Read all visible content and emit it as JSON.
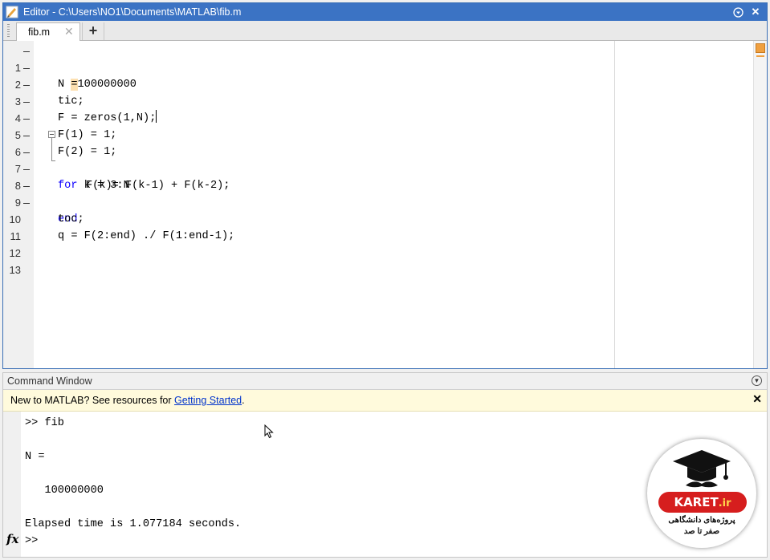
{
  "editor": {
    "title": "Editor - C:\\Users\\NO1\\Documents\\MATLAB\\fib.m",
    "tab_label": "fib.m",
    "tab_close": "✕",
    "tab_add": "+",
    "minimize_glyph": "▾",
    "close_glyph": "✕",
    "line_numbers": [
      "1",
      "2",
      "3",
      "4",
      "5",
      "6",
      "7",
      "8",
      "9",
      "10",
      "11",
      "12",
      "13"
    ],
    "lines": {
      "l1_pre": "N ",
      "l1_hl": "=",
      "l1_post": "100000000",
      "l2": "tic;",
      "l3": "F = zeros(1,N);",
      "l4": "F(1) = 1;",
      "l5": "F(2) = 1;",
      "l6_kw": "for",
      "l6_rest": " k = 3:N",
      "l7": "F(k)= F(k-1) + F(k-2);",
      "l8_kw": "end",
      "l9": "toc;",
      "l10": "q = F(2:end) ./ F(1:end-1);"
    }
  },
  "command_window": {
    "title": "Command Window",
    "info_text": "New to MATLAB? See resources for ",
    "info_link": "Getting Started",
    "info_suffix": ".",
    "info_close": "✕",
    "output": {
      "cmd": ">> fib",
      "n_label": "N =",
      "n_value": "   100000000",
      "elapsed": "Elapsed time is 1.077184 seconds.",
      "prompt": ">>"
    },
    "fx_label": "fx"
  },
  "watermark": {
    "brand": "KARET",
    "brand_domain": ".ir",
    "line1": "پروژه‌های دانشگاهی",
    "line2": "صفر تا صد"
  },
  "colors": {
    "title_bar": "#3b73c4",
    "keyword": "#0e00ff",
    "info_bar": "#fffadc",
    "link": "#0033cc",
    "brand_red": "#d61e1e"
  }
}
